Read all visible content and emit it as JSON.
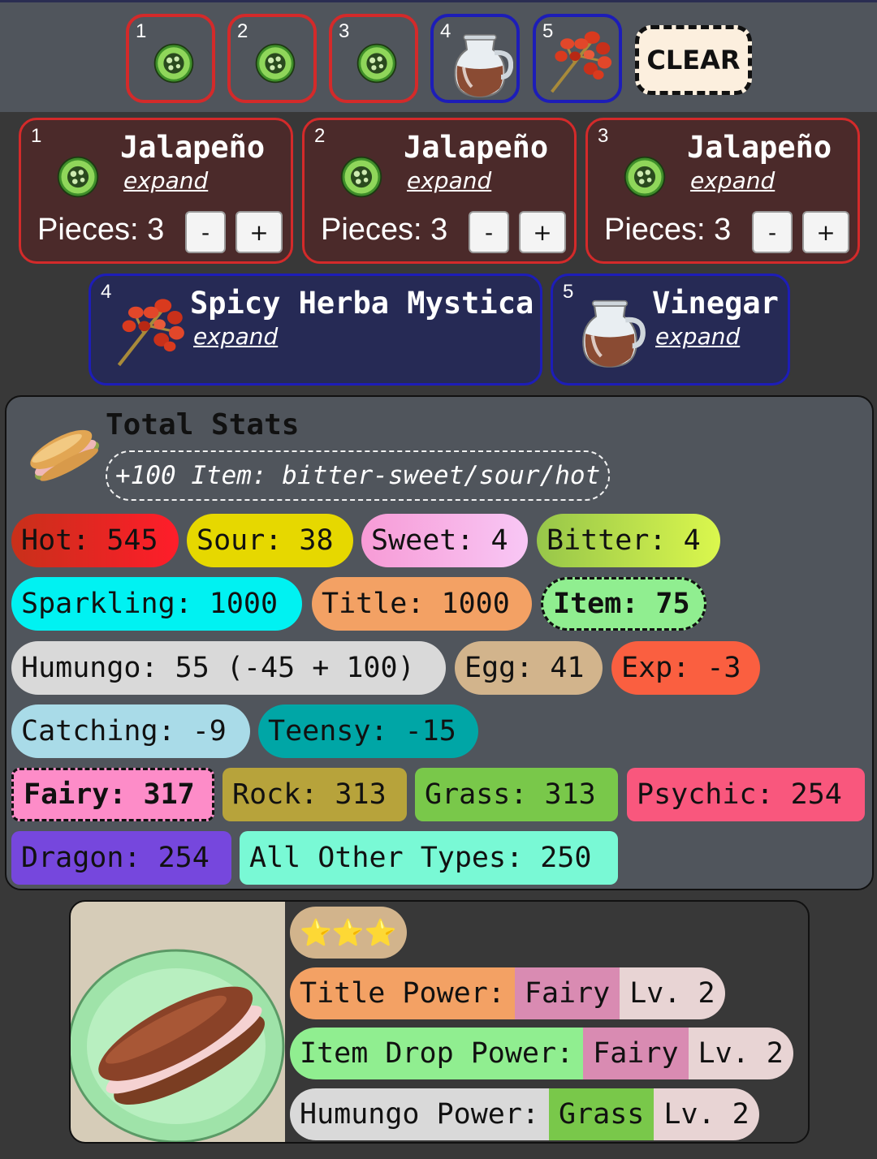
{
  "slots": [
    {
      "number": "1",
      "icon": "jalapeno-icon",
      "color": "#d42a2a"
    },
    {
      "number": "2",
      "icon": "jalapeno-icon",
      "color": "#d42a2a"
    },
    {
      "number": "3",
      "icon": "jalapeno-icon",
      "color": "#d42a2a"
    },
    {
      "number": "4",
      "icon": "vinegar-icon",
      "color": "#1d1db8"
    },
    {
      "number": "5",
      "icon": "spicy-herba-icon",
      "color": "#1d1db8"
    }
  ],
  "clear_label": "CLEAR",
  "fillings": [
    {
      "number": "1",
      "name": "Jalapeño",
      "expand": "expand",
      "pieces_label": "Pieces: 3",
      "minus": "-",
      "plus": "+"
    },
    {
      "number": "2",
      "name": "Jalapeño",
      "expand": "expand",
      "pieces_label": "Pieces: 3",
      "minus": "-",
      "plus": "+"
    },
    {
      "number": "3",
      "name": "Jalapeño",
      "expand": "expand",
      "pieces_label": "Pieces: 3",
      "minus": "-",
      "plus": "+"
    }
  ],
  "condiments": [
    {
      "number": "4",
      "name": "Spicy Herba Mystica",
      "expand": "expand"
    },
    {
      "number": "5",
      "name": "Vinegar",
      "expand": "expand"
    }
  ],
  "stats": {
    "title": "Total Stats",
    "bonus": "+100 Item: bitter-sweet/sour/hot",
    "flavors": [
      {
        "label": "Hot: 545",
        "color": "#e02020"
      },
      {
        "label": "Sour: 38",
        "color": "#e6d800"
      },
      {
        "label": "Sweet: 4",
        "color": "#f7a6e6"
      },
      {
        "label": "Bitter: 4",
        "color": "#b9d33d"
      }
    ],
    "powers": [
      {
        "label": "Sparkling: 1000",
        "color": "#00f2f2"
      },
      {
        "label": "Title: 1000",
        "color": "#f3a164"
      },
      {
        "label": "Item: 75",
        "color": "#90ee90"
      },
      {
        "label": "Humungo: 55 (-45 + 100)",
        "color": "#d9d9d9"
      },
      {
        "label": "Egg: 41",
        "color": "#d2b48c"
      },
      {
        "label": "Exp: -3",
        "color": "#fa5f40"
      },
      {
        "label": "Catching: -9",
        "color": "#a9dbe8"
      },
      {
        "label": "Teensy: -15",
        "color": "#00a6a6"
      }
    ],
    "types": [
      {
        "label": "Fairy: 317",
        "color": "#fd8cc8"
      },
      {
        "label": "Rock: 313",
        "color": "#b7a33b"
      },
      {
        "label": "Grass: 313",
        "color": "#79c84a"
      },
      {
        "label": "Psychic: 254",
        "color": "#f9577d"
      },
      {
        "label": "Dragon: 254",
        "color": "#7647dd"
      },
      {
        "label": "All Other Types: 250",
        "color": "#79f9d5"
      }
    ]
  },
  "result": {
    "stars": "⭐⭐⭐",
    "powers": [
      {
        "name": "Title Power:",
        "type": "Fairy",
        "level": "Lv. 2",
        "name_color": "#f3a164",
        "type_color": "#d98bb2"
      },
      {
        "name": "Item Drop Power:",
        "type": "Fairy",
        "level": "Lv. 2",
        "name_color": "#90ee90",
        "type_color": "#d98bb2"
      },
      {
        "name": "Humungo Power:",
        "type": "Grass",
        "level": "Lv. 2",
        "name_color": "#d9d9d9",
        "type_color": "#79c84a"
      }
    ]
  }
}
